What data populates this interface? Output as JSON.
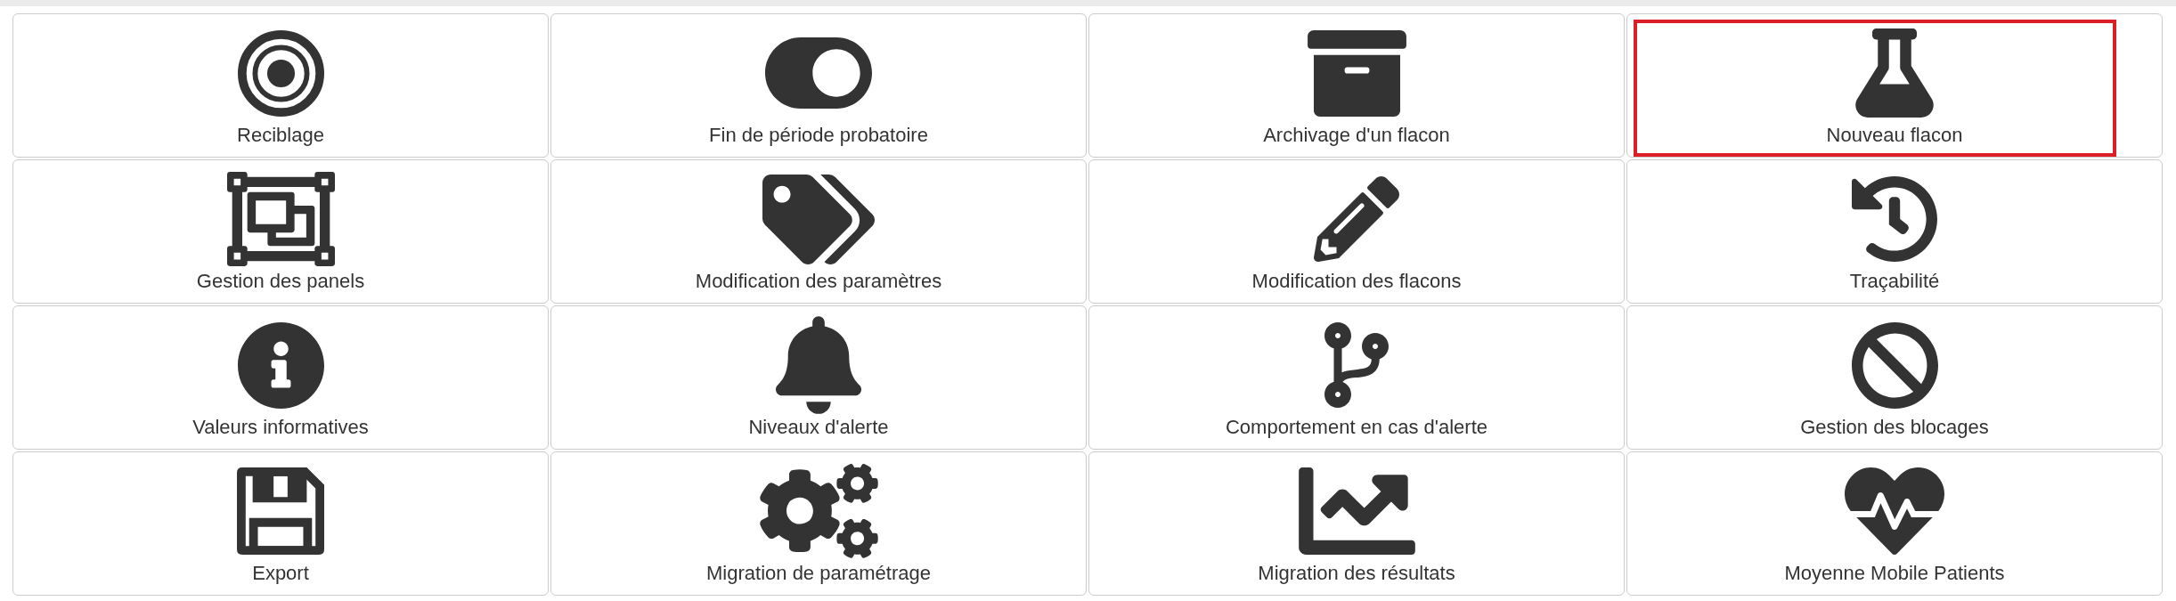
{
  "tiles": [
    {
      "label": "Reciblage",
      "selected": false
    },
    {
      "label": "Fin de période probatoire",
      "selected": false
    },
    {
      "label": "Archivage d'un flacon",
      "selected": false
    },
    {
      "label": "Nouveau flacon",
      "selected": true
    },
    {
      "label": "Gestion des panels",
      "selected": false
    },
    {
      "label": "Modification des paramètres",
      "selected": false
    },
    {
      "label": "Modification des flacons",
      "selected": false
    },
    {
      "label": "Traçabilité",
      "selected": false
    },
    {
      "label": "Valeurs informatives",
      "selected": false
    },
    {
      "label": "Niveaux d'alerte",
      "selected": false
    },
    {
      "label": "Comportement en cas d'alerte",
      "selected": false
    },
    {
      "label": "Gestion des blocages",
      "selected": false
    },
    {
      "label": "Export",
      "selected": false
    },
    {
      "label": "Migration de paramétrage",
      "selected": false
    },
    {
      "label": "Migration des résultats",
      "selected": false
    },
    {
      "label": "Moyenne Mobile Patients",
      "selected": false
    }
  ]
}
